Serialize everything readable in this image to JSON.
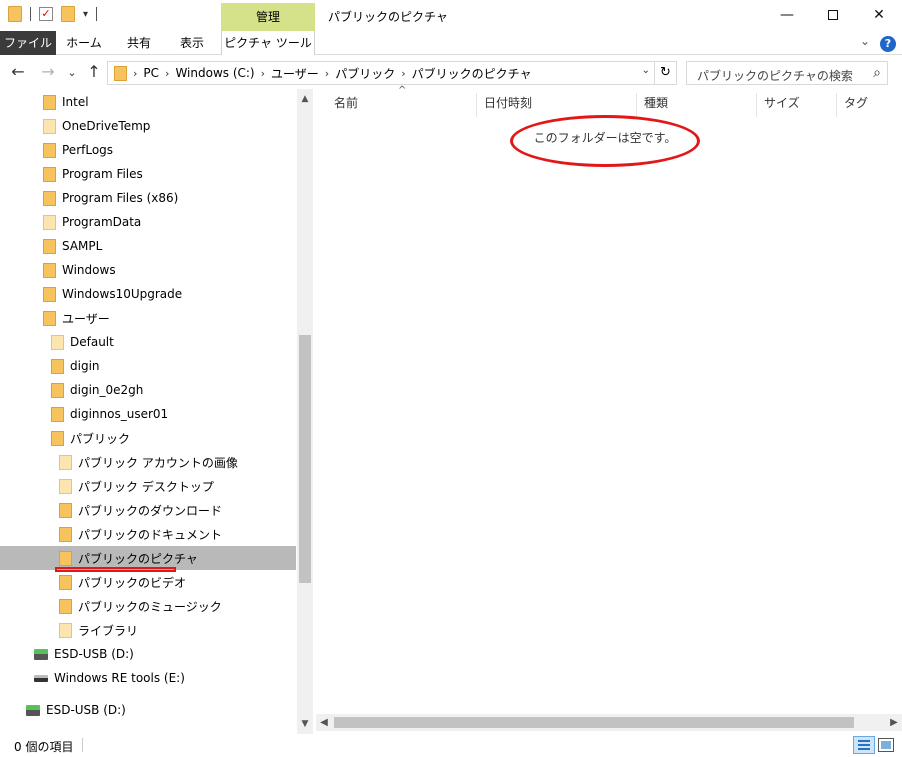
{
  "titlebar": {
    "context_tab": "管理",
    "title": "パブリックのピクチャ",
    "minimize_icon": "—",
    "close_icon": "✕"
  },
  "ribbon": {
    "tabs": [
      "ファイル",
      "ホーム",
      "共有",
      "表示",
      "ピクチャ ツール"
    ],
    "help_icon": "?"
  },
  "address": {
    "crumbs": [
      "PC",
      "Windows (C:)",
      "ユーザー",
      "パブリック",
      "パブリックのピクチャ"
    ]
  },
  "search": {
    "placeholder": "パブリックのピクチャの検索"
  },
  "nav_tree": [
    {
      "label": "Intel"
    },
    {
      "label": "OneDriveTemp"
    },
    {
      "label": "PerfLogs"
    },
    {
      "label": "Program Files"
    },
    {
      "label": "Program Files (x86)"
    },
    {
      "label": "ProgramData"
    },
    {
      "label": "SAMPL"
    },
    {
      "label": "Windows"
    },
    {
      "label": "Windows10Upgrade"
    },
    {
      "label": "ユーザー"
    },
    {
      "label": "Default"
    },
    {
      "label": "digin"
    },
    {
      "label": "digin_0e2gh"
    },
    {
      "label": "diginnos_user01"
    },
    {
      "label": "パブリック"
    },
    {
      "label": "パブリック アカウントの画像"
    },
    {
      "label": "パブリック デスクトップ"
    },
    {
      "label": "パブリックのダウンロード"
    },
    {
      "label": "パブリックのドキュメント"
    },
    {
      "label": "パブリックのピクチャ"
    },
    {
      "label": "パブリックのビデオ"
    },
    {
      "label": "パブリックのミュージック"
    },
    {
      "label": "ライブラリ"
    },
    {
      "label": "ESD-USB (D:)"
    },
    {
      "label": "Windows RE tools (E:)"
    },
    {
      "label": "ESD-USB (D:)"
    }
  ],
  "columns": [
    "名前",
    "日付時刻",
    "種類",
    "サイズ",
    "タグ"
  ],
  "empty_message": "このフォルダーは空です。",
  "status": {
    "item_count": "0 個の項目"
  }
}
